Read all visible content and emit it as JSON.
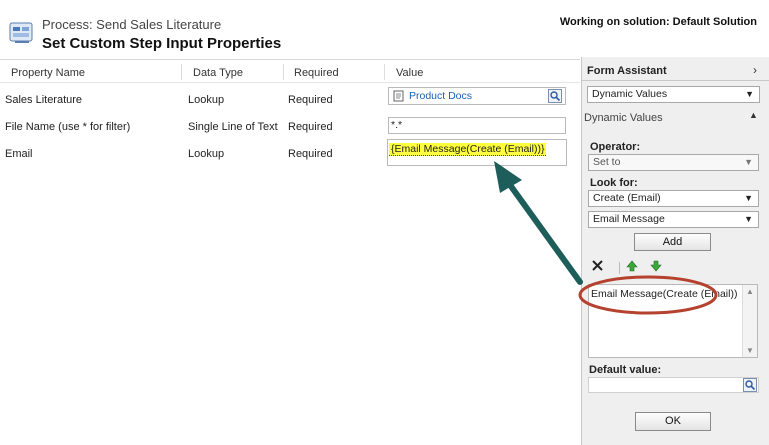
{
  "header": {
    "process_line": "Process: Send Sales Literature",
    "title": "Set Custom Step Input Properties",
    "solution": "Working on solution: Default Solution"
  },
  "grid": {
    "columns": [
      "Property Name",
      "Data Type",
      "Required",
      "Value"
    ],
    "rows": [
      {
        "name": "Sales Literature",
        "type": "Lookup",
        "required": "Required",
        "value": "Product Docs"
      },
      {
        "name": "File Name (use * for filter)",
        "type": "Single Line of Text",
        "required": "Required",
        "value": "*.*"
      },
      {
        "name": "Email",
        "type": "Lookup",
        "required": "Required",
        "value": "{Email Message(Create (Email))}"
      }
    ]
  },
  "assistant": {
    "title": "Form Assistant",
    "mode_select": "Dynamic Values",
    "section_title": "Dynamic Values",
    "operator_label": "Operator:",
    "operator_value": "Set to",
    "look_for_label": "Look for:",
    "look_for_value": "Create (Email)",
    "entity_value": "Email Message",
    "add_label": "Add",
    "list_item": "Email Message(Create (Email))",
    "default_label": "Default value:",
    "ok_label": "OK"
  },
  "colors": {
    "highlight": "#ffff3c",
    "annotation_arrow": "#1d5d5a",
    "annotation_ellipse": "#b5412f",
    "link": "#1b60b0"
  }
}
